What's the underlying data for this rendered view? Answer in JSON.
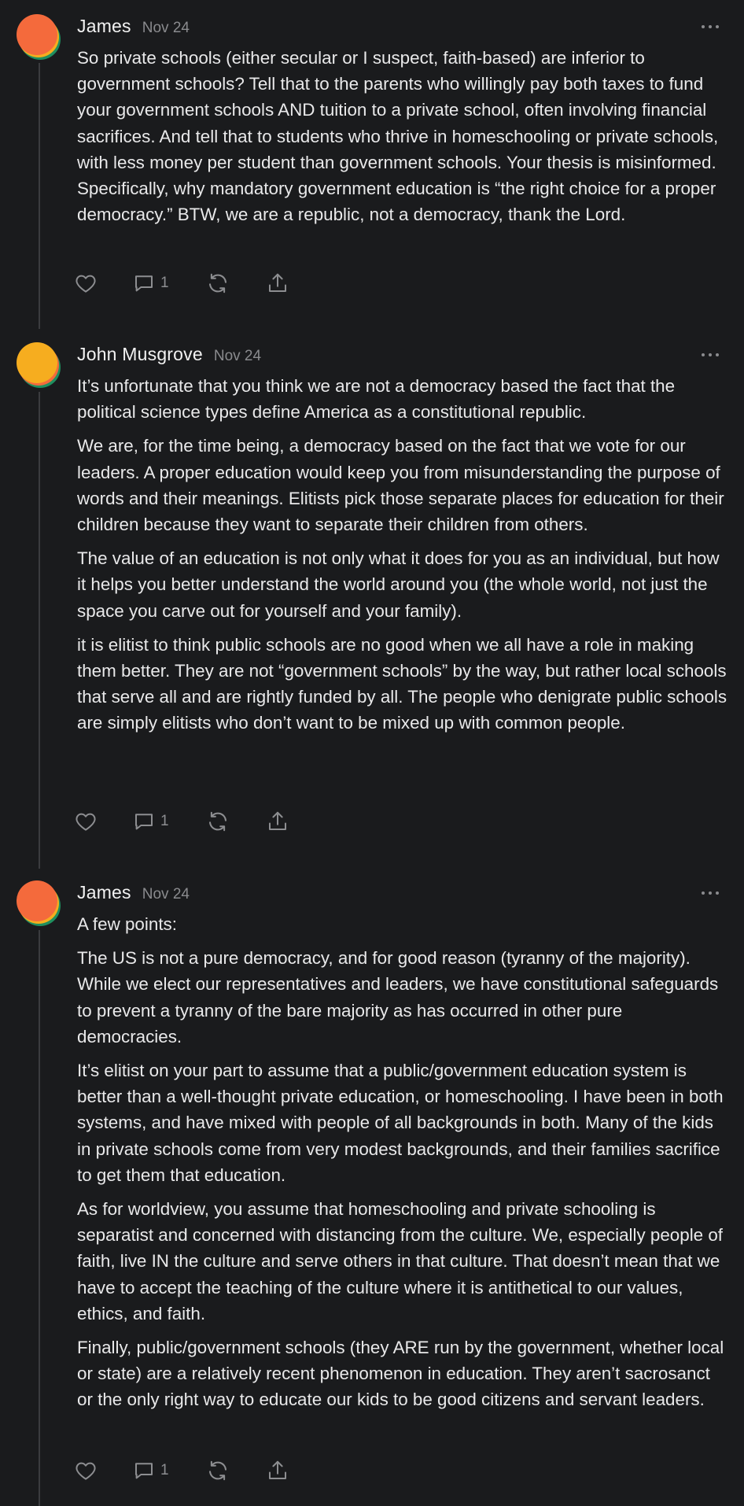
{
  "comments": [
    {
      "author": "James",
      "date": "Nov 24",
      "paragraphs": [
        "So private schools (either secular or I suspect, faith-based) are inferior to government schools? Tell that to the parents who willingly pay both taxes to fund your government schools AND tuition to a private school, often involving financial sacrifices. And tell that to students who thrive in homeschooling or private schools, with less money per student than government schools. Your thesis is misinformed. Specifically, why mandatory government education is “the right choice for a proper democracy.” BTW, we are a republic, not a democracy, thank the Lord."
      ],
      "reply_count": "1",
      "icons": [
        "heart-icon",
        "comment-icon",
        "restack-icon",
        "share-icon",
        "more-icon"
      ]
    },
    {
      "author": "John Musgrove",
      "date": "Nov 24",
      "paragraphs": [
        "It’s unfortunate that you think we are not a democracy based the fact that the political science types define America as a constitutional republic.",
        "We are, for the time being, a democracy based on the fact that we vote for our leaders. A proper education would keep you from misunderstanding the purpose of words and their meanings. Elitists pick those separate places for education for their children because they want to separate their children from others.",
        "The value of an education is not only what it does for you as an individual, but how it helps you better understand the world around you (the whole world, not just the space you carve out for yourself and your family).",
        "it is elitist to think public schools are no good when we all have a role in making them better. They are not “government schools” by the way, but rather local schools that serve all and are rightly funded by all. The people who denigrate public schools are simply elitists who don’t want to be mixed up with common people."
      ],
      "reply_count": "1",
      "icons": [
        "heart-icon",
        "comment-icon",
        "restack-icon",
        "share-icon",
        "more-icon"
      ]
    },
    {
      "author": "James",
      "date": "Nov 24",
      "paragraphs": [
        "A few points:",
        "The US is not a pure democracy, and for good reason (tyranny of the majority). While we elect our representatives and leaders, we have constitutional safeguards to prevent a tyranny of the bare majority as has occurred in other pure democracies.",
        "It’s elitist on your part to assume that a public/government education system is better than a well-thought private education, or homeschooling. I have been in both systems, and have mixed with people of all backgrounds in both. Many of the kids in private schools come from very modest backgrounds, and their families sacrifice to get them that education.",
        "As for worldview, you assume that homeschooling and private schooling is separatist and concerned with distancing from the culture. We, especially people of faith, live IN the culture and serve others in that culture. That doesn’t mean that we have to accept the teaching of the culture where it is antithetical to our values, ethics, and faith.",
        "Finally, public/government schools (they ARE run by the government, whether local or state) are a relatively recent phenomenon in education. They aren’t sacrosanct or the only right way to educate our kids to be good citizens and servant leaders."
      ],
      "reply_count": "1",
      "icons": [
        "heart-icon",
        "comment-icon",
        "restack-icon",
        "share-icon",
        "more-icon"
      ]
    }
  ],
  "colors": {
    "background": "#1a1b1d",
    "text": "#e9e9ea",
    "muted": "#8a8b8e",
    "thread_line": "#3b3c3f",
    "avatar_orange": "#f46a3c",
    "avatar_yellow": "#f6ad1f",
    "avatar_green": "#1f8f5f"
  }
}
